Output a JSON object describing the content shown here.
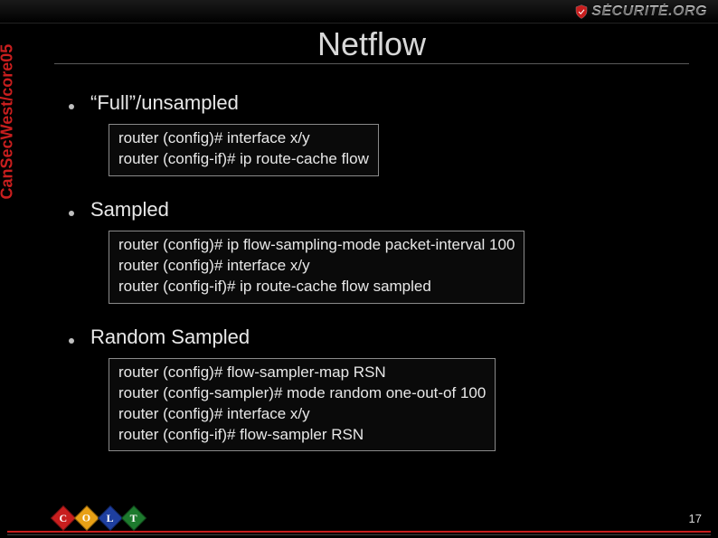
{
  "header": {
    "brand_text": "SÉCURITÉ.ORG"
  },
  "sidebar": {
    "conference_label": "CanSecWest/core05"
  },
  "slide": {
    "title": "Netflow",
    "sections": [
      {
        "heading": "“Full”/unsampled",
        "code": [
          "router (config)# interface x/y",
          "router (config-if)# ip route-cache flow"
        ]
      },
      {
        "heading": "Sampled",
        "code": [
          "router (config)# ip flow-sampling-mode packet-interval 100",
          "router (config)# interface x/y",
          "router (config-if)# ip route-cache flow sampled"
        ]
      },
      {
        "heading": "Random Sampled",
        "code": [
          "router (config)# flow-sampler-map RSN",
          "router (config-sampler)# mode random one-out-of 100",
          "router (config)# interface x/y",
          "router (config-if)# flow-sampler RSN"
        ]
      }
    ]
  },
  "footer": {
    "page_number": "17",
    "sponsor_letters": [
      "C",
      "O",
      "L",
      "T"
    ]
  }
}
